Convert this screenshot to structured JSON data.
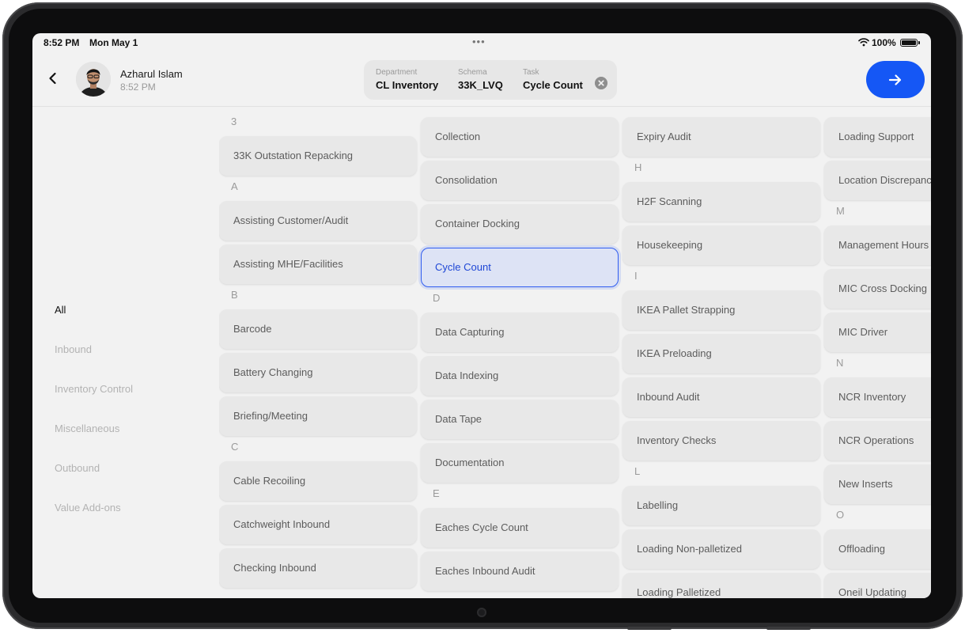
{
  "status_bar": {
    "time": "8:52 PM",
    "date": "Mon May 1",
    "battery": "100%"
  },
  "user": {
    "name": "Azharul Islam",
    "time": "8:52 PM"
  },
  "context": {
    "department_label": "Department",
    "department_value": "CL Inventory",
    "schema_label": "Schema",
    "schema_value": "33K_LVQ",
    "task_label": "Task",
    "task_value": "Cycle Count"
  },
  "colors": {
    "accent": "#1557f5",
    "selected_border": "#2f5cf0",
    "selected_fill": "#dde3f5",
    "card_bg": "#e8e8e8"
  },
  "sidebar": {
    "items": [
      "All",
      "Inbound",
      "Inventory Control",
      "Miscellaneous",
      "Outbound",
      "Value Add-ons"
    ],
    "active": "All"
  },
  "columns": [
    [
      {
        "letter": "3"
      },
      {
        "task": "33K Outstation Repacking"
      },
      {
        "letter": "A"
      },
      {
        "task": "Assisting Customer/Audit"
      },
      {
        "task": "Assisting MHE/Facilities"
      },
      {
        "letter": "B"
      },
      {
        "task": "Barcode"
      },
      {
        "task": "Battery Changing"
      },
      {
        "task": "Briefing/Meeting"
      },
      {
        "letter": "C"
      },
      {
        "task": "Cable Recoiling"
      },
      {
        "task": "Catchweight Inbound"
      },
      {
        "task": "Checking Inbound"
      }
    ],
    [
      {
        "task": "Collection"
      },
      {
        "task": "Consolidation"
      },
      {
        "task": "Container Docking"
      },
      {
        "task": "Cycle Count",
        "selected": true
      },
      {
        "letter": "D"
      },
      {
        "task": "Data Capturing"
      },
      {
        "task": "Data Indexing"
      },
      {
        "task": "Data Tape"
      },
      {
        "task": "Documentation"
      },
      {
        "letter": "E"
      },
      {
        "task": "Eaches Cycle Count"
      },
      {
        "task": "Eaches Inbound Audit"
      }
    ],
    [
      {
        "task": "Expiry Audit"
      },
      {
        "letter": "H"
      },
      {
        "task": "H2F Scanning"
      },
      {
        "task": "Housekeeping"
      },
      {
        "letter": "I"
      },
      {
        "task": "IKEA Pallet Strapping"
      },
      {
        "task": "IKEA Preloading"
      },
      {
        "task": "Inbound Audit"
      },
      {
        "task": "Inventory Checks"
      },
      {
        "letter": "L"
      },
      {
        "task": "Labelling"
      },
      {
        "task": "Loading Non-palletized"
      },
      {
        "task": "Loading Palletized"
      }
    ],
    [
      {
        "task": "Loading Support"
      },
      {
        "task": "Location Discrepancy"
      },
      {
        "letter": "M"
      },
      {
        "task": "Management Hours"
      },
      {
        "task": "MIC Cross Docking"
      },
      {
        "task": "MIC Driver"
      },
      {
        "letter": "N"
      },
      {
        "task": "NCR Inventory"
      },
      {
        "task": "NCR Operations"
      },
      {
        "task": "New Inserts"
      },
      {
        "letter": "O"
      },
      {
        "task": "Offloading"
      },
      {
        "task": "Oneil Updating"
      }
    ]
  ]
}
